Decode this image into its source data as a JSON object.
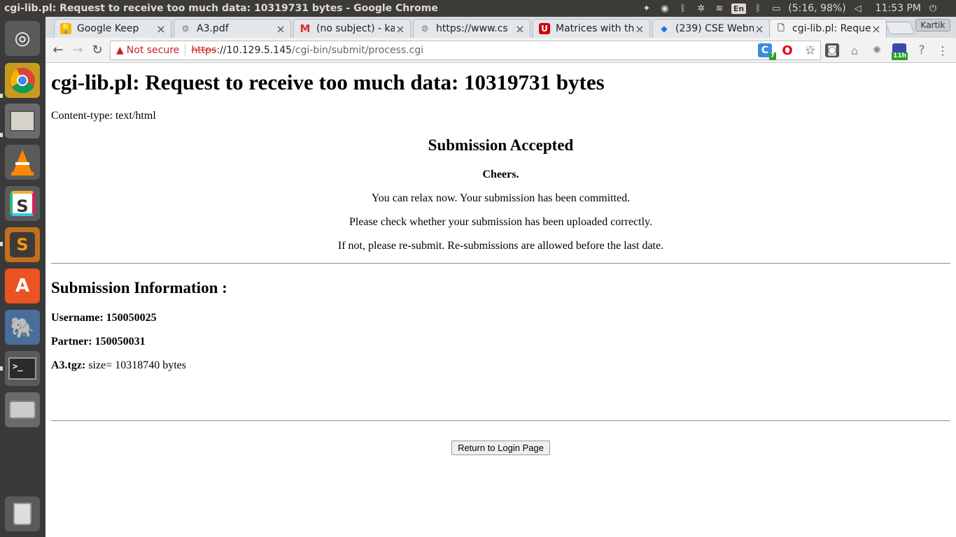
{
  "os": {
    "window_title": "cgi-lib.pl: Request to receive too much data: 10319731 bytes - Google Chrome",
    "keyboard": "En",
    "battery": "(5:16, 98%)",
    "clock": "11:53 PM"
  },
  "tabs": [
    {
      "label": "Google Keep",
      "icon": "keep-icon",
      "color": "#f4b400"
    },
    {
      "label": "A3.pdf",
      "icon": "globe-icon",
      "color": "#777777"
    },
    {
      "label": "(no subject) - ka",
      "icon": "gmail-icon",
      "color": "#d93025"
    },
    {
      "label": "https://www.cs",
      "icon": "globe-icon",
      "color": "#777777"
    },
    {
      "label": "Matrices with th",
      "icon": "utah-icon",
      "color": "#cc0000"
    },
    {
      "label": "(239) CSE Webm",
      "icon": "webmail-icon",
      "color": "#1a73e8"
    },
    {
      "label": "cgi-lib.pl: Reque",
      "icon": "page-icon",
      "color": "#555555"
    }
  ],
  "profile_name": "Kartik",
  "address": {
    "security": "Not secure",
    "scheme": "https",
    "host": "://10.129.5.145",
    "path": "/cgi-bin/submit/process.cgi"
  },
  "extensions": {
    "badge_1": "7",
    "badge_2": "11h"
  },
  "page": {
    "heading": "cgi-lib.pl: Request to receive too much data: 10319731 bytes",
    "content_type": "Content-type: text/html",
    "accepted_title": "Submission Accepted",
    "cheers": "Cheers.",
    "line1": "You can relax now. Your submission has been committed.",
    "line2": "Please check whether your submission has been uploaded correctly.",
    "line3": "If not, please re-submit. Re-submissions are allowed before the last date.",
    "info_title": "Submission Information :",
    "username_label": "Username: 150050025",
    "partner_label": "Partner: 150050031",
    "file_label": "A3.tgz:",
    "file_size": " size= 10318740 bytes",
    "return_button": "Return to Login Page"
  }
}
